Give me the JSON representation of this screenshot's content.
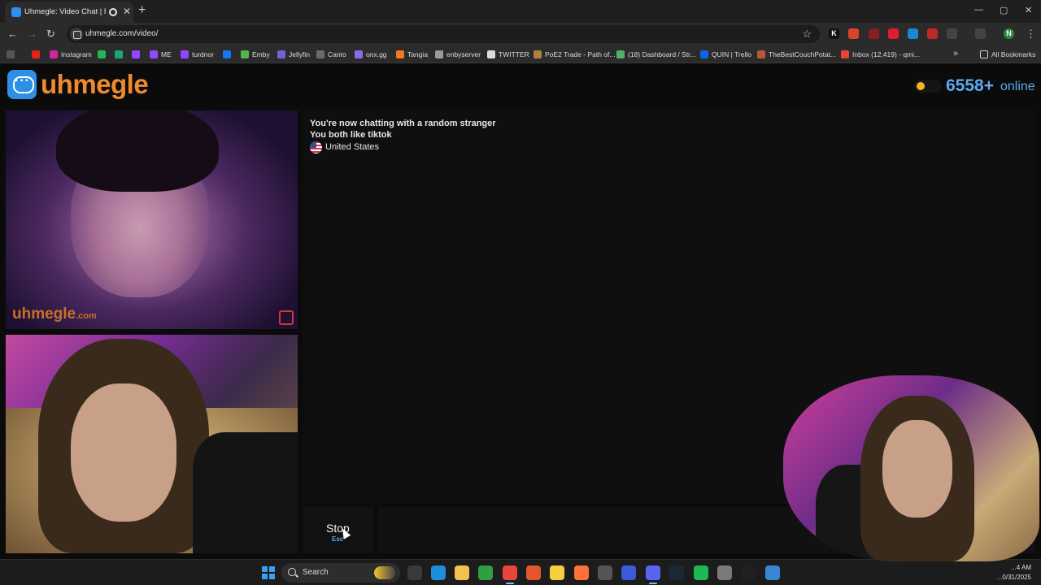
{
  "browser": {
    "tab_title": "Uhmegle: Video Chat | Rand...",
    "url": "uhmegle.com/video/",
    "window_controls": {
      "minimize": "—",
      "maximize": "▢",
      "close": "✕"
    },
    "profile_initial": "N",
    "bookmarks": [
      {
        "label": "",
        "icon": "youtube-icon",
        "color": "#e62117"
      },
      {
        "label": "Instagram",
        "icon": "instagram-icon",
        "color": "#d6249f"
      },
      {
        "label": "",
        "icon": "spotify-icon",
        "color": "#1db954"
      },
      {
        "label": "",
        "icon": "chat-icon",
        "color": "#1da37d"
      },
      {
        "label": "",
        "icon": "twitch-icon",
        "color": "#9146ff"
      },
      {
        "label": "ME",
        "icon": "twitch-icon",
        "color": "#9146ff"
      },
      {
        "label": "turdnor",
        "icon": "twitch-icon",
        "color": "#9146ff"
      },
      {
        "label": "",
        "icon": "facebook-icon",
        "color": "#1877f2"
      },
      {
        "label": "Emby",
        "icon": "emby-icon",
        "color": "#52b54b"
      },
      {
        "label": "Jellyfin",
        "icon": "jellyfin-icon",
        "color": "#7a5fd6"
      },
      {
        "label": "Canto",
        "icon": "canto-icon",
        "color": "#6b6b6b"
      },
      {
        "label": "onx.gg",
        "icon": "onx-icon",
        "color": "#8a6ce6"
      },
      {
        "label": "Tangia",
        "icon": "tangia-icon",
        "color": "#f07a22"
      },
      {
        "label": "enbyserver",
        "icon": "globe-icon",
        "color": "#9a9a9a"
      },
      {
        "label": "TWITTER",
        "icon": "x-icon",
        "color": "#dcdcdc"
      },
      {
        "label": "PoE2 Trade - Path of...",
        "icon": "poe-icon",
        "color": "#b08040"
      },
      {
        "label": "(18) Dashboard / Str...",
        "icon": "dashboard-icon",
        "color": "#4fb06a"
      },
      {
        "label": "QUIN | Trello",
        "icon": "trello-icon",
        "color": "#0c66e4"
      },
      {
        "label": "TheBestCouchPotat...",
        "icon": "couch-icon",
        "color": "#b45a3a"
      },
      {
        "label": "Inbox (12,419) - qmi...",
        "icon": "gmail-icon",
        "color": "#ea4335"
      }
    ],
    "all_bookmarks_label": "All Bookmarks"
  },
  "site": {
    "logo_text": "uhmegle",
    "online_count": "6558+",
    "online_label": "online",
    "watermark": "uhmegle",
    "watermark_suffix": ".com"
  },
  "chat": {
    "status_line": "You're now chatting with a random stranger",
    "interest_line": "You both like tiktok",
    "country": "United States",
    "stop_label": "Stop",
    "stop_key": "Esc"
  },
  "taskbar": {
    "search_label": "Search",
    "time": "...4 AM",
    "date": "...0/31/2025",
    "apps": [
      {
        "name": "system-icon",
        "color": "#3a3a3a"
      },
      {
        "name": "edge-icon",
        "color": "#1c8fd8"
      },
      {
        "name": "folder-icon",
        "color": "#f2c14e"
      },
      {
        "name": "play-icon",
        "color": "#2ea043"
      },
      {
        "name": "chrome-icon",
        "color": "#e8453c"
      },
      {
        "name": "ball-icon",
        "color": "#e4572e"
      },
      {
        "name": "notes-icon",
        "color": "#f4d03f"
      },
      {
        "name": "firefox-icon",
        "color": "#ff7139"
      },
      {
        "name": "obs-icon",
        "color": "#555555"
      },
      {
        "name": "app-icon",
        "color": "#3b5bdb"
      },
      {
        "name": "discord-icon",
        "color": "#5865f2"
      },
      {
        "name": "steam-icon",
        "color": "#1b2838"
      },
      {
        "name": "spotify-icon",
        "color": "#1db954"
      },
      {
        "name": "paint-icon",
        "color": "#7a7a7a"
      },
      {
        "name": "capcut-icon",
        "color": "#202020"
      },
      {
        "name": "notepad-icon",
        "color": "#3a86d6"
      }
    ]
  }
}
